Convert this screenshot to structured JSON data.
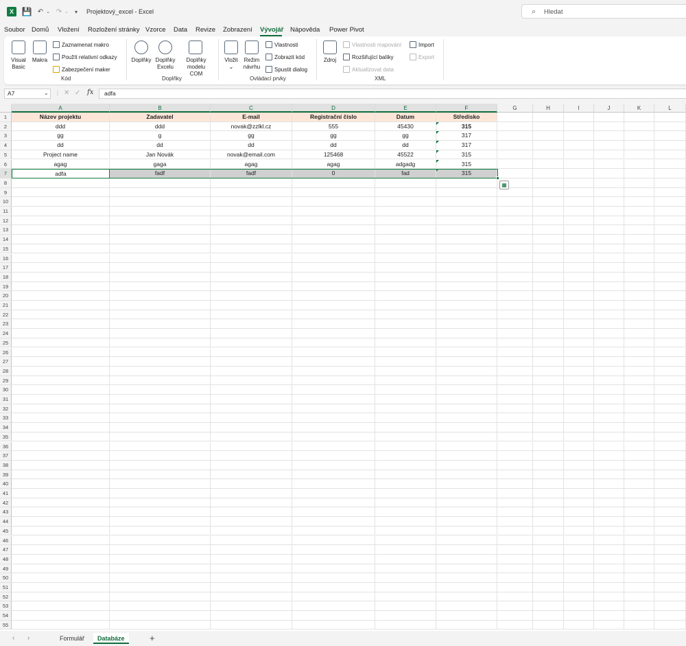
{
  "app": {
    "window_title": "Projektový_excel  -  Excel",
    "search_placeholder": "Hledat"
  },
  "menu": {
    "tabs": [
      "Soubor",
      "Domů",
      "Vložení",
      "Rozložení stránky",
      "Vzorce",
      "Data",
      "Revize",
      "Zobrazení",
      "Vývojář",
      "Nápověda",
      "Power Pivot"
    ],
    "active_tab": "Vývojář"
  },
  "ribbon": {
    "code": {
      "label": "Kód",
      "visual_basic": "Visual\nBasic",
      "macros": "Makra",
      "record_macro": "Zaznamenat makro",
      "relative_refs": "Použít relativní odkazy",
      "macro_security": "Zabezpečení maker"
    },
    "addins": {
      "label": "Doplňky",
      "addins": "Doplňky",
      "excel_addins": "Doplňky\nExcelu",
      "com_addins": "Doplňky\nmodelu COM"
    },
    "controls": {
      "label": "Ovládací prvky",
      "insert": "Vložit",
      "design_mode": "Režim\nnávrhu",
      "properties": "Vlastnosti",
      "view_code": "Zobrazit kód",
      "run_dialog": "Spustit dialog"
    },
    "xml": {
      "label": "XML",
      "source": "Zdroj",
      "map_properties": "Vlastnosti mapování",
      "expansion_packs": "Rozšiřující balíky",
      "refresh_data": "Aktualizovat data",
      "import": "Import",
      "export": "Export"
    }
  },
  "formula_bar": {
    "name_box": "A7",
    "fx": "fx",
    "value": "adfa"
  },
  "sheet": {
    "columns": [
      "A",
      "B",
      "C",
      "D",
      "E",
      "F",
      "G",
      "H",
      "I",
      "J",
      "K",
      "L"
    ],
    "header_row": [
      "Název projektu",
      "Zadavatel",
      "E-mail",
      "Registrační číslo",
      "Datum",
      "Středisko"
    ],
    "rows": [
      [
        "ddd",
        "ddd",
        "novak@zzlkl.cz",
        "555",
        "45430",
        "315"
      ],
      [
        "gg",
        "g",
        "gg",
        "gg",
        "gg",
        "317"
      ],
      [
        "dd",
        "dd",
        "dd",
        "dd",
        "dd",
        "317"
      ],
      [
        "Project name",
        "Jan Novák",
        "novak@email.com",
        "125468",
        "45522",
        "315"
      ],
      [
        "agag",
        "gaga",
        "agag",
        "agag",
        "adgadg",
        "315"
      ],
      [
        "adfa",
        "fadf",
        "fadf",
        "0",
        "fad",
        "315"
      ]
    ],
    "row_count": 55,
    "selected_row": 7
  },
  "sheet_tabs": {
    "tabs": [
      "Formulář",
      "Databáze"
    ],
    "active": "Databáze",
    "add_label": "+"
  }
}
